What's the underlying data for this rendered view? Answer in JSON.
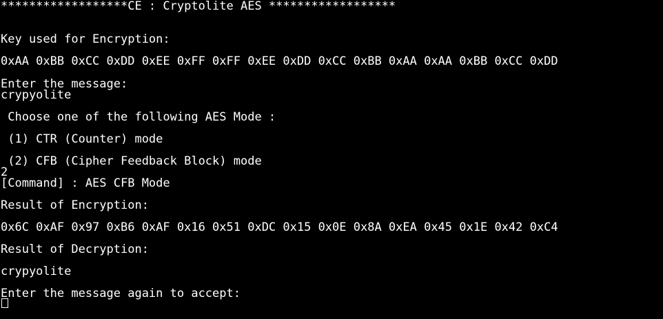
{
  "terminal": {
    "title_line": "******************CE : Cryptolite AES ******************",
    "key_label": "Key used for Encryption:",
    "key_value": "0xAA 0xBB 0xCC 0xDD 0xEE 0xFF 0xFF 0xEE 0xDD 0xCC 0xBB 0xAA 0xAA 0xBB 0xCC 0xDD",
    "enter_message_prompt": "Enter the message:",
    "entered_message": "crypyolite",
    "choose_mode_prompt": " Choose one of the following AES Mode :",
    "mode_option_1": " (1) CTR (Counter) mode",
    "mode_option_2": " (2) CFB (Cipher Feedback Block) mode",
    "user_choice": "2",
    "command_line": "[Command] : AES CFB Mode",
    "encryption_result_label": "Result of Encryption:",
    "encryption_result_value": "0x6C 0xAF 0x97 0xB6 0xAF 0x16 0x51 0xDC 0x15 0x0E 0x8A 0xEA 0x45 0x1E 0x42 0xC4",
    "decryption_result_label": "Result of Decryption:",
    "decryption_result_value": "crypyolite",
    "enter_again_prompt": "Enter the message again to accept:"
  },
  "colors": {
    "background": "#000000",
    "text": "#ffffff"
  }
}
